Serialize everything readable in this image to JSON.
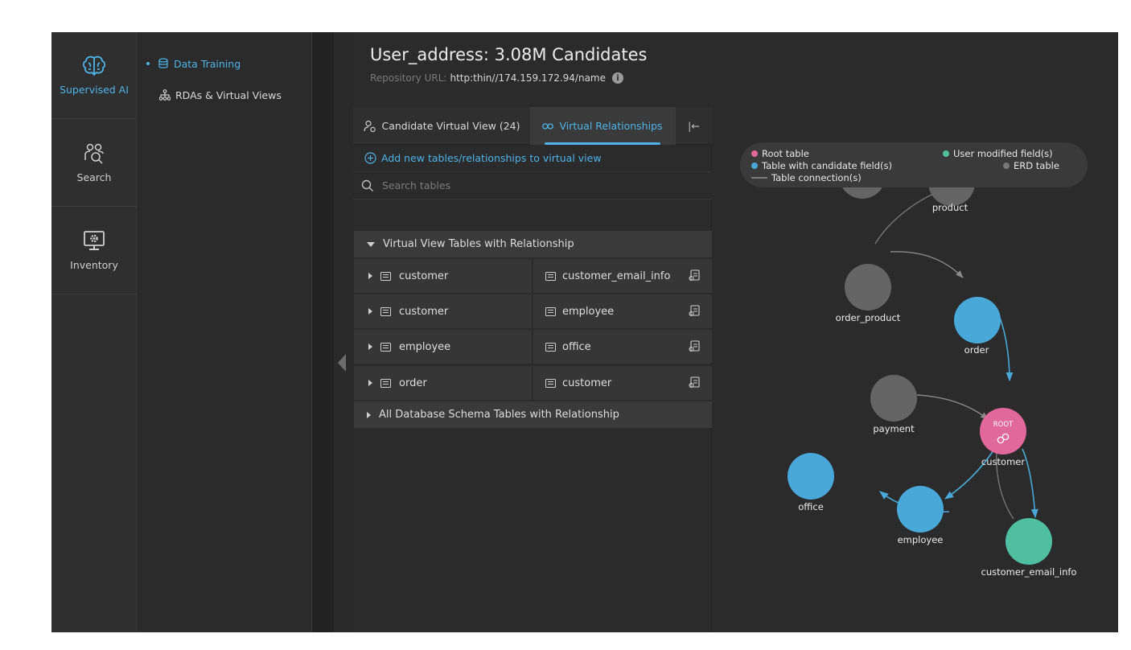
{
  "rail": {
    "items": [
      {
        "label": "Supervised AI",
        "icon": "brain-icon"
      },
      {
        "label": "Search",
        "icon": "people-search-icon"
      },
      {
        "label": "Inventory",
        "icon": "monitor-gear-icon"
      }
    ]
  },
  "subnav": {
    "items": [
      {
        "label": "Data Training",
        "icon": "database-icon"
      },
      {
        "label": "RDAs & Virtual Views",
        "icon": "hierarchy-icon"
      }
    ]
  },
  "header": {
    "title": "User_address: 3.08M Candidates",
    "repo_label": "Repository URL:",
    "repo_url": "http:thin//174.159.172.94/name"
  },
  "tabs": {
    "candidate": "Candidate Virtual View (24)",
    "virtual": "Virtual Relationships",
    "collapse": "|←"
  },
  "add_link": "Add new tables/relationships to virtual view",
  "search": {
    "placeholder": "Search tables"
  },
  "sections": {
    "virtual": "Virtual View Tables with Relationship",
    "all": "All Database Schema Tables with Relationship"
  },
  "relationships": [
    {
      "left": "customer",
      "right": "customer_email_info"
    },
    {
      "left": "customer",
      "right": "employee"
    },
    {
      "left": "employee",
      "right": "office"
    },
    {
      "left": "order",
      "right": "customer"
    }
  ],
  "legend": {
    "root": "Root table",
    "candidate": "Table with candidate field(s)",
    "connection": "Table connection(s)",
    "modified": "User modified field(s)",
    "erd": "ERD table"
  },
  "colors": {
    "accent": "#4fb3e8",
    "root": "#e0689a",
    "candidate": "#4aa8d8",
    "modified": "#4fbf9f",
    "erd": "#656565"
  },
  "graph": {
    "root_tag": "ROOT",
    "nodes": {
      "product": "product",
      "order_product": "order_product",
      "order": "order",
      "payment": "payment",
      "customer": "customer",
      "office": "office",
      "employee": "employee",
      "customer_email_info": "customer_email_info"
    }
  }
}
